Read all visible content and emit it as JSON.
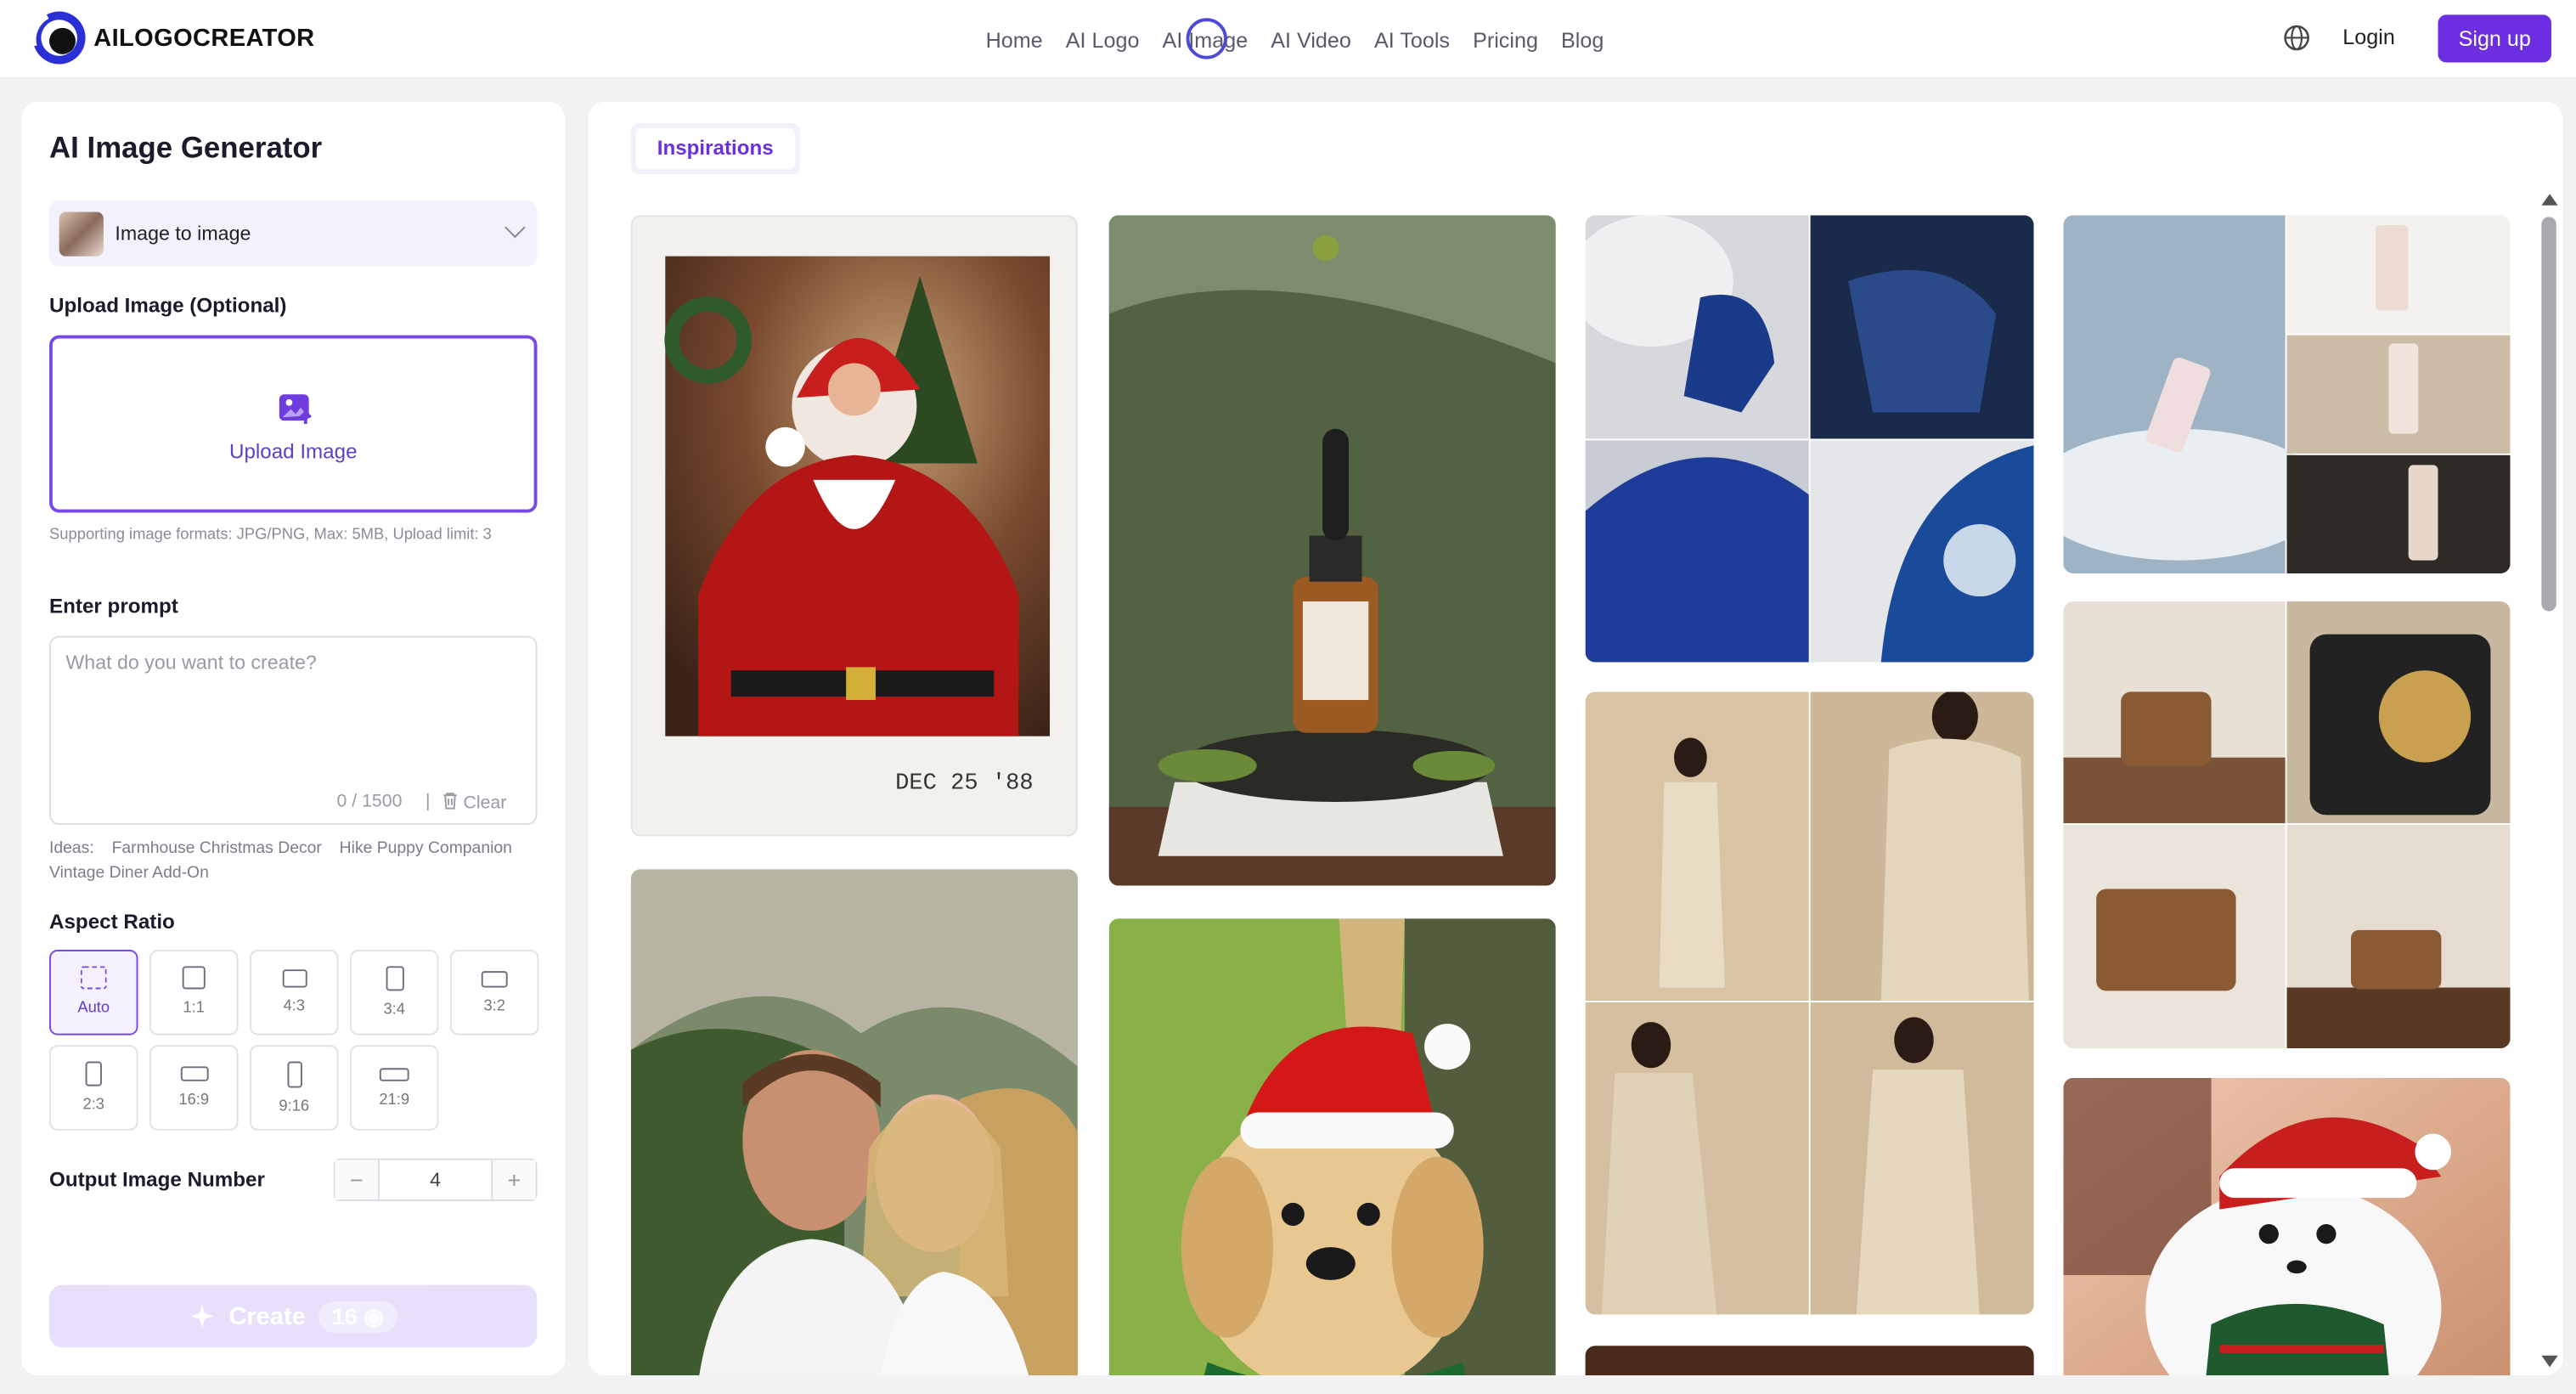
{
  "brand": {
    "name": "AILOGOCREATOR",
    "accent": "#6c2ee0"
  },
  "nav": {
    "items": [
      "Home",
      "AI Logo",
      "AI Image",
      "AI Video",
      "AI Tools",
      "Pricing",
      "Blog"
    ],
    "login": "Login",
    "signup": "Sign up"
  },
  "panel": {
    "title": "AI Image Generator",
    "mode": "Image to image",
    "upload_label": "Upload Image (Optional)",
    "upload_button": "Upload Image",
    "upload_hint": "Supporting image formats: JPG/PNG, Max: 5MB, Upload limit: 3",
    "prompt_label": "Enter prompt",
    "prompt_placeholder": "What do you want to create?",
    "prompt_value": "",
    "char_count": "0 / 1500",
    "clear": "Clear",
    "ideas_label": "Ideas:",
    "ideas": [
      "Farmhouse Christmas Decor",
      "Hike Puppy Companion",
      "Vintage Diner Add-On"
    ],
    "aspect_label": "Aspect Ratio",
    "ratios": [
      "Auto",
      "1:1",
      "4:3",
      "3:4",
      "3:2",
      "2:3",
      "16:9",
      "9:16",
      "21:9"
    ],
    "selected_ratio": "Auto",
    "output_label": "Output Image Number",
    "output_value": "4",
    "minus": "−",
    "plus": "+",
    "create": "Create",
    "cost": "16"
  },
  "gallery": {
    "tab": "Inspirations",
    "polaroid_caption": "DEC 25 '88",
    "items": [
      "santa-polaroid",
      "serum-bottle",
      "blue-chair-grid",
      "body-lotion-grid",
      "couple-selfie",
      "puppy-santa-hat",
      "beige-suit-grid",
      "wooden-radio-grid",
      "white-dog-sweater",
      "partial-tile"
    ]
  }
}
